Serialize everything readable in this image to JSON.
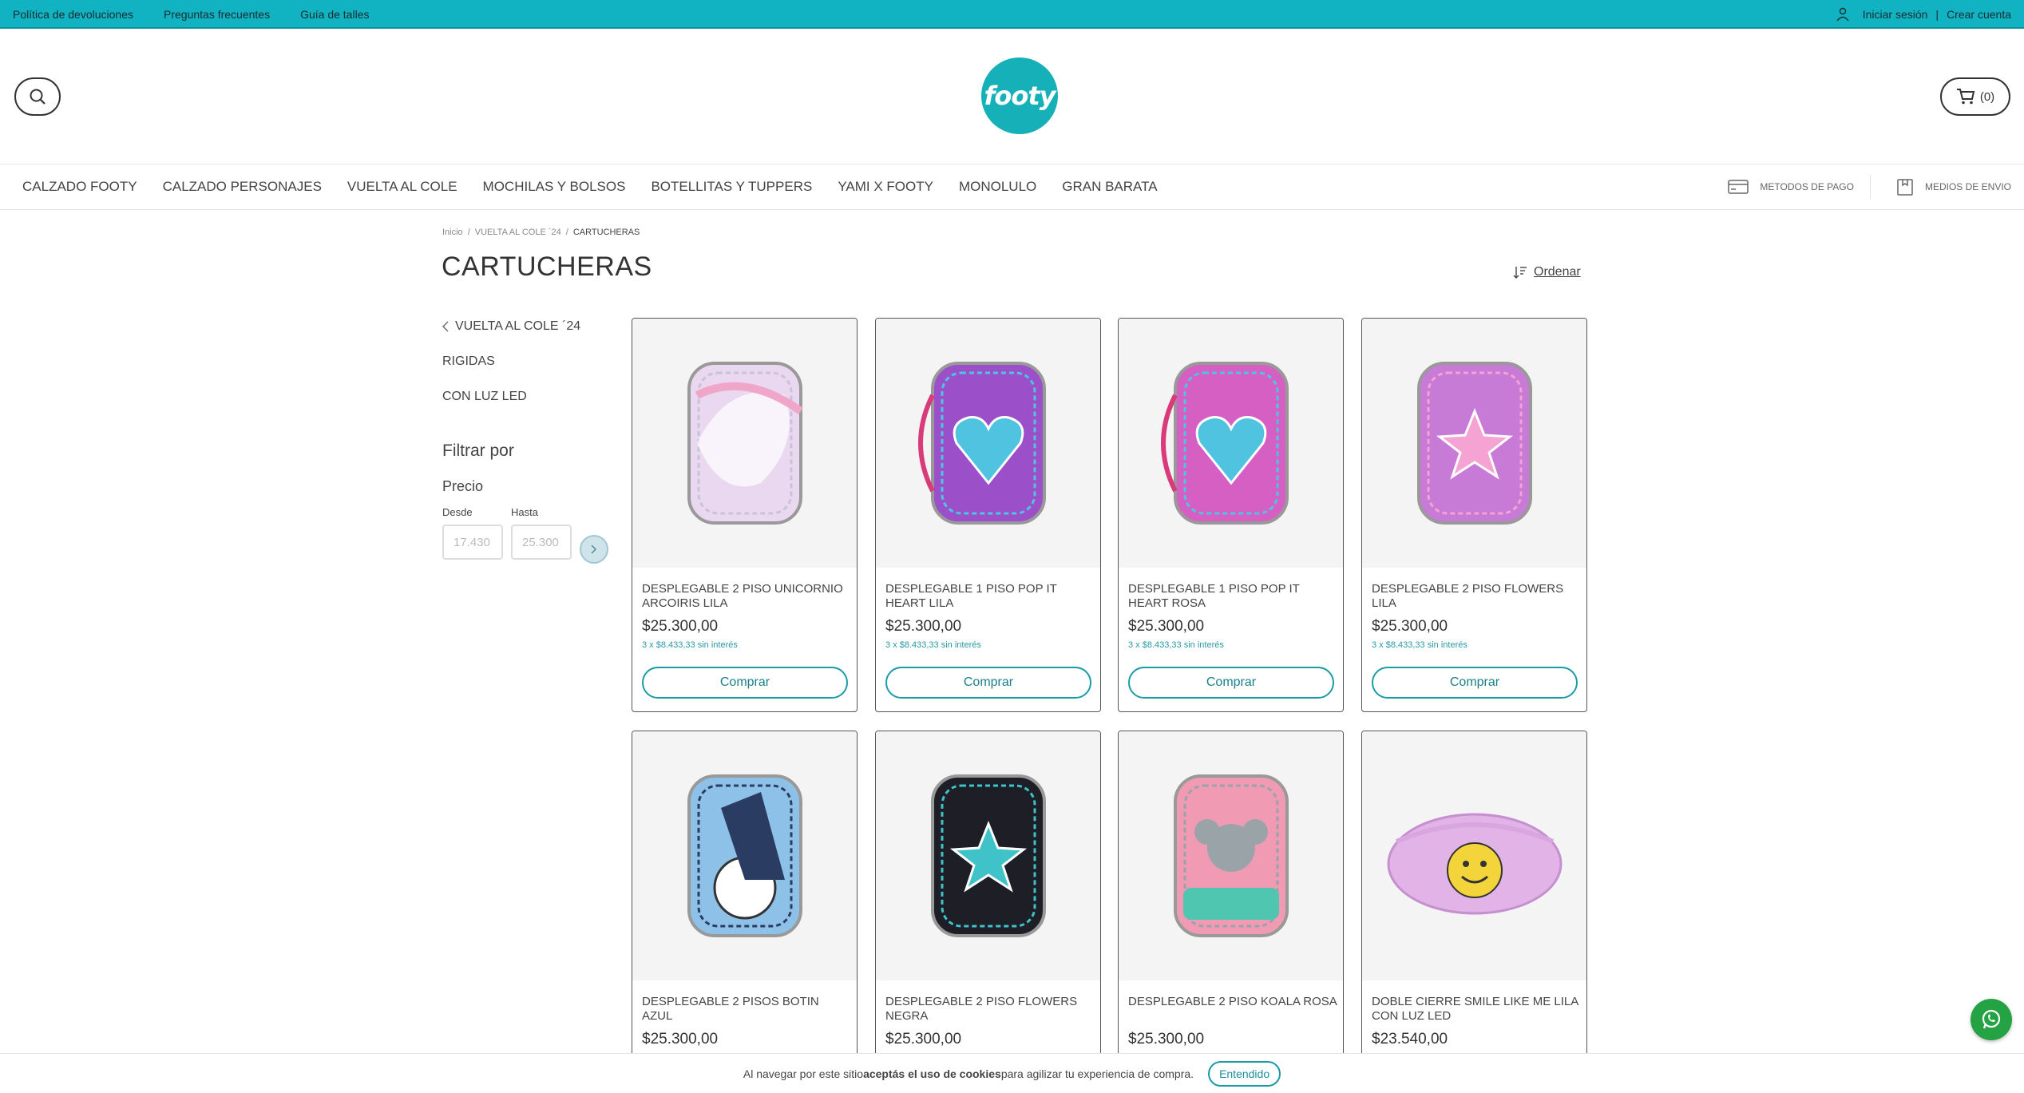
{
  "topbar": {
    "links": [
      "Política de devoluciones",
      "Preguntas frecuentes",
      "Guía de talles"
    ],
    "login": "Iniciar sesión",
    "separator": "|",
    "register": "Crear cuenta",
    "bg_color": "#11b3c3"
  },
  "header": {
    "logo_text": "footy",
    "cart_count": "(0)"
  },
  "nav": {
    "items": [
      "CALZADO FOOTY",
      "CALZADO PERSONAJES",
      "VUELTA AL COLE",
      "MOCHILAS Y BOLSOS",
      "BOTELLITAS Y TUPPERS",
      "YAMI X FOOTY",
      "MONOLULO",
      "GRAN BARATA"
    ],
    "payment": "METODOS DE PAGO",
    "shipping": "MEDIOS DE ENVIO"
  },
  "breadcrumb": {
    "home": "Inicio",
    "parent": "VUELTA AL COLE ´24",
    "current": "CARTUCHERAS",
    "sep": "/"
  },
  "page": {
    "title": "CARTUCHERAS",
    "sort_label": "Ordenar"
  },
  "sidebar": {
    "back_label": "VUELTA AL COLE ´24",
    "subcategories": [
      "RIGIDAS",
      "CON LUZ LED"
    ],
    "filter_title": "Filtrar por",
    "price_title": "Precio",
    "from_label": "Desde",
    "to_label": "Hasta",
    "from_placeholder": "17.430",
    "to_placeholder": "25.300"
  },
  "products": [
    {
      "name": "DESPLEGABLE 2 PISO UNICORNIO ARCOIRIS LILA",
      "price": "$25.300,00",
      "installments": "3 x $8.433,33 sin interés",
      "buy": "Comprar",
      "color": "#e9d8f0",
      "accent": "#c9c3d9"
    },
    {
      "name": "DESPLEGABLE 1 PISO POP IT HEART LILA",
      "price": "$25.300,00",
      "installments": "3 x $8.433,33 sin interés",
      "buy": "Comprar",
      "color": "#9b4fc9",
      "accent": "#4fc3e0"
    },
    {
      "name": "DESPLEGABLE 1 PISO POP IT HEART ROSA",
      "price": "$25.300,00",
      "installments": "3 x $8.433,33 sin interés",
      "buy": "Comprar",
      "color": "#d65fc4",
      "accent": "#4fc3e0"
    },
    {
      "name": "DESPLEGABLE 2 PISO FLOWERS LILA",
      "price": "$25.300,00",
      "installments": "3 x $8.433,33 sin interés",
      "buy": "Comprar",
      "color": "#c77ad6",
      "accent": "#f5a3d2"
    },
    {
      "name": "DESPLEGABLE 2 PISOS BOTIN AZUL",
      "price": "$25.300,00",
      "installments": "",
      "buy": "",
      "color": "#8ec1e8",
      "accent": "#2b3c62"
    },
    {
      "name": "DESPLEGABLE 2 PISO FLOWERS NEGRA",
      "price": "$25.300,00",
      "installments": "",
      "buy": "",
      "color": "#1e1e26",
      "accent": "#3fc3c9"
    },
    {
      "name": "DESPLEGABLE 2 PISO KOALA ROSA",
      "price": "$25.300,00",
      "installments": "",
      "buy": "",
      "color": "#f19ab4",
      "accent": "#9aa3a8"
    },
    {
      "name": "DOBLE CIERRE SMILE LIKE ME LILA CON LUZ LED",
      "price": "$23.540,00",
      "installments": "",
      "buy": "",
      "color": "#e2b3e6",
      "accent": "#f3d43a"
    }
  ],
  "cookie": {
    "pre": "Al navegar por este sitio ",
    "bold": "aceptás el uso de cookies",
    "post": " para agilizar tu experiencia de compra.",
    "button": "Entendido"
  }
}
